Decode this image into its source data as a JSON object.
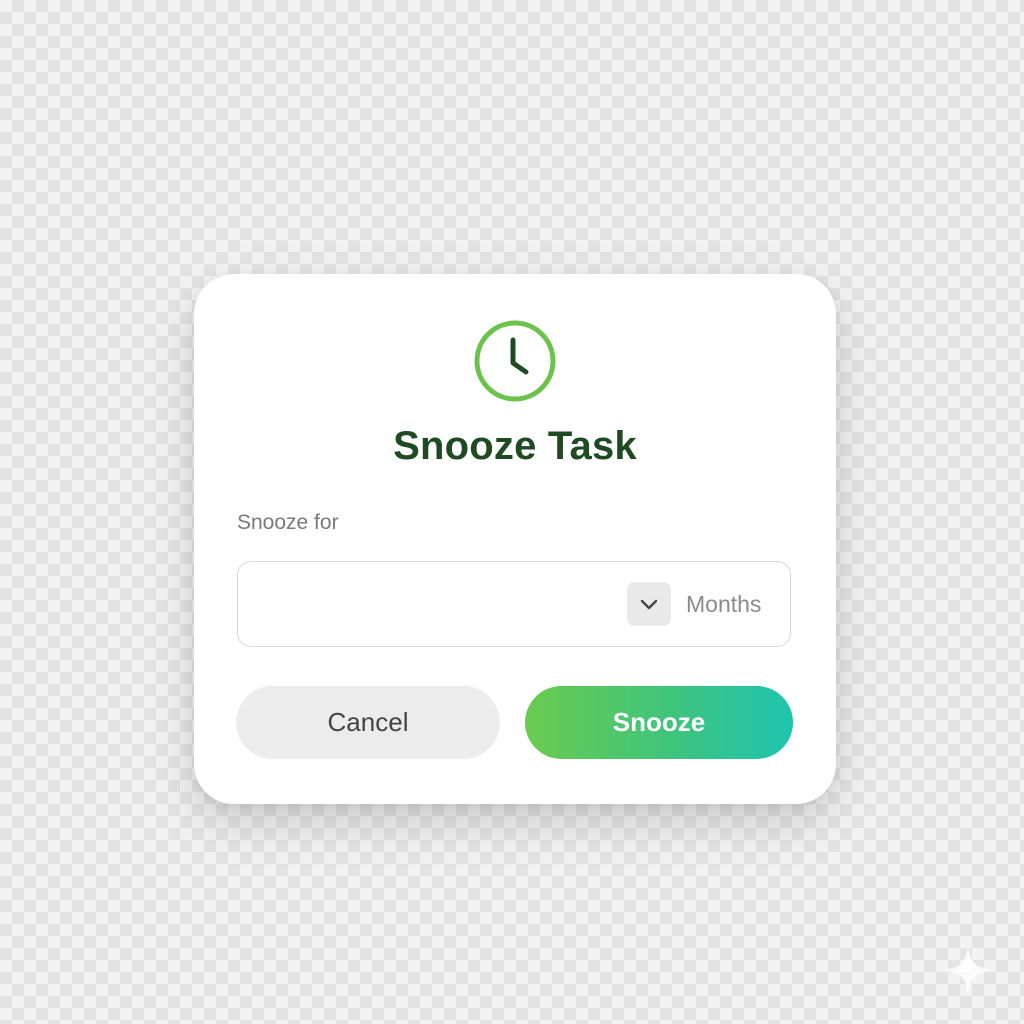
{
  "dialog": {
    "title": "Snooze Task",
    "icon": "clock-icon",
    "field_label": "Snooze for",
    "select": {
      "value": "",
      "unit": "Months",
      "icon": "chevron-down-icon"
    },
    "buttons": {
      "cancel_label": "Cancel",
      "snooze_label": "Snooze"
    }
  },
  "colors": {
    "accent_green": "#6cc24a",
    "title_dark_green": "#1f4a22",
    "snooze_gradient_start": "#6ccb4f",
    "snooze_gradient_end": "#1fc4b0",
    "cancel_bg": "#ececec"
  }
}
